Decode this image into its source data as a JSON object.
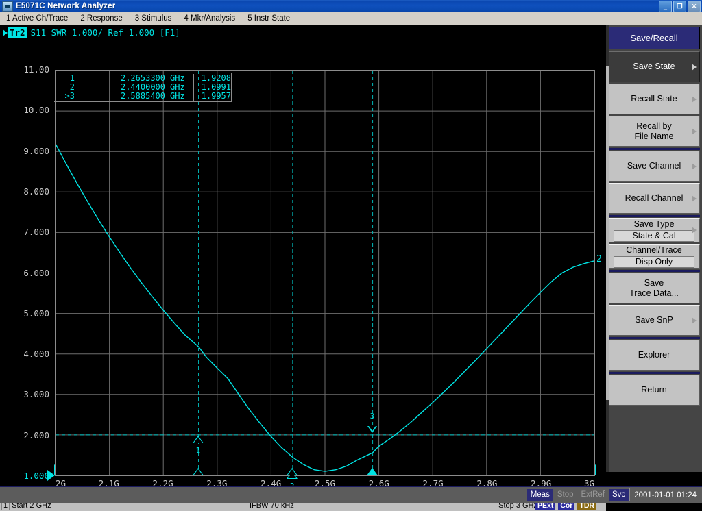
{
  "window": {
    "title": "E5071C Network Analyzer",
    "icon": "analyzer-icon",
    "minimize": "_",
    "restore": "❐",
    "close": "✕"
  },
  "menubar": {
    "items": [
      {
        "label": "1 Active Ch/Trace"
      },
      {
        "label": "2 Response"
      },
      {
        "label": "3 Stimulus"
      },
      {
        "label": "4 Mkr/Analysis"
      },
      {
        "label": "5 Instr State"
      }
    ]
  },
  "trace_header": {
    "pointer": "▶",
    "trace_badge": "Tr2",
    "text": "S11  SWR 1.000/ Ref 1.000 [F1]"
  },
  "marker_table": {
    "rows": [
      {
        "id": "1",
        "freq": "2.2653300",
        "unit": "GHz",
        "value": "1.9208"
      },
      {
        "id": "2",
        "freq": "2.4400000",
        "unit": "GHz",
        "value": "1.0991"
      },
      {
        "id": ">3",
        "freq": "2.5885400",
        "unit": "GHz",
        "value": "1.9957"
      }
    ]
  },
  "chart_data": {
    "type": "line",
    "title": "S11 SWR",
    "xlabel": "",
    "ylabel": "SWR",
    "grid": true,
    "legend": false,
    "trace_label": "2",
    "x_unit": "Hz",
    "xlim": [
      2000000000,
      3000000000
    ],
    "ylim": [
      1.0,
      11.0
    ],
    "y_per_div": 1.0,
    "y_reference": 1.0,
    "yticks": [
      "11.00",
      "10.00",
      "9.000",
      "8.000",
      "7.000",
      "6.000",
      "5.000",
      "4.000",
      "3.000",
      "2.000",
      "1.000"
    ],
    "xticks": [
      "2G",
      "2.1G",
      "2.2G",
      "2.3G",
      "2.4G",
      "2.5G",
      "2.6G",
      "2.7G",
      "2.8G",
      "2.9G",
      "3G"
    ],
    "series": [
      {
        "name": "S11 SWR",
        "color": "#00e5e5",
        "x": [
          2.0,
          2.02,
          2.04,
          2.06,
          2.08,
          2.1,
          2.12,
          2.14,
          2.16,
          2.18,
          2.2,
          2.22,
          2.24,
          2.2653,
          2.28,
          2.3,
          2.32,
          2.34,
          2.36,
          2.38,
          2.4,
          2.42,
          2.44,
          2.46,
          2.48,
          2.5,
          2.52,
          2.54,
          2.56,
          2.5885,
          2.6,
          2.62,
          2.64,
          2.66,
          2.68,
          2.7,
          2.72,
          2.74,
          2.76,
          2.78,
          2.8,
          2.82,
          2.84,
          2.86,
          2.88,
          2.9,
          2.92,
          2.94,
          2.96,
          2.98,
          3.0
        ],
        "y": [
          9.19,
          8.69,
          8.21,
          7.75,
          7.31,
          6.89,
          6.49,
          6.11,
          5.75,
          5.41,
          5.08,
          4.77,
          4.47,
          4.18,
          3.92,
          3.65,
          3.39,
          3.0,
          2.62,
          2.28,
          1.96,
          1.68,
          1.45,
          1.27,
          1.14,
          1.1,
          1.14,
          1.23,
          1.38,
          1.56,
          1.72,
          1.9,
          2.1,
          2.32,
          2.56,
          2.8,
          3.05,
          3.31,
          3.58,
          3.85,
          4.13,
          4.41,
          4.69,
          4.97,
          5.25,
          5.52,
          5.78,
          6.0,
          6.14,
          6.23,
          6.3
        ]
      }
    ],
    "markers": [
      {
        "id": "1",
        "label": "1",
        "x_ghz": 2.26533,
        "value": 1.9208,
        "active": false
      },
      {
        "id": "2",
        "label": "2",
        "x_ghz": 2.44,
        "value": 1.0991,
        "active": false
      },
      {
        "id": "3",
        "label": "3",
        "x_ghz": 2.58854,
        "value": 1.9957,
        "active": true
      }
    ]
  },
  "status_line": {
    "channel": "1",
    "start": "Start 2 GHz",
    "ifbw": "IFBW 70 kHz",
    "stop": "Stop 3 GHz",
    "badges": [
      {
        "label": "PExt",
        "color": "#2b2b9e"
      },
      {
        "label": "Cor",
        "color": "#2b2b9e"
      },
      {
        "label": "TDR",
        "color": "#8a6a12"
      }
    ]
  },
  "softkeys": {
    "title": "Save/Recall",
    "items": [
      {
        "label": "Save State",
        "arrow": true,
        "selected": true,
        "value": null,
        "sep_before": false
      },
      {
        "label": "Recall State",
        "arrow": true,
        "selected": false,
        "value": null,
        "sep_before": false
      },
      {
        "label": "Recall by\nFile Name",
        "arrow": true,
        "selected": false,
        "value": null,
        "sep_before": false
      },
      {
        "label": "Save Channel",
        "arrow": true,
        "selected": false,
        "value": null,
        "sep_before": true
      },
      {
        "label": "Recall Channel",
        "arrow": true,
        "selected": false,
        "value": null,
        "sep_before": false
      },
      {
        "label": "Save Type",
        "arrow": true,
        "selected": false,
        "value": "State & Cal",
        "sep_before": true
      },
      {
        "label": "Channel/Trace",
        "arrow": false,
        "selected": false,
        "value": "Disp Only",
        "sep_before": false
      },
      {
        "label": "Save\nTrace Data...",
        "arrow": false,
        "selected": false,
        "value": null,
        "sep_before": true
      },
      {
        "label": "Save SnP",
        "arrow": true,
        "selected": false,
        "value": null,
        "sep_before": false
      },
      {
        "label": "Explorer",
        "arrow": false,
        "selected": false,
        "value": null,
        "sep_before": true
      },
      {
        "label": "Return",
        "arrow": false,
        "selected": false,
        "value": null,
        "sep_before": true
      }
    ]
  },
  "taskbar": {
    "buttons": [
      {
        "label": "Meas",
        "state": "on"
      },
      {
        "label": "Stop",
        "state": "off"
      },
      {
        "label": "ExtRef",
        "state": "off"
      },
      {
        "label": "Svc",
        "state": "on"
      }
    ],
    "clock": "2001-01-01 01:24"
  }
}
